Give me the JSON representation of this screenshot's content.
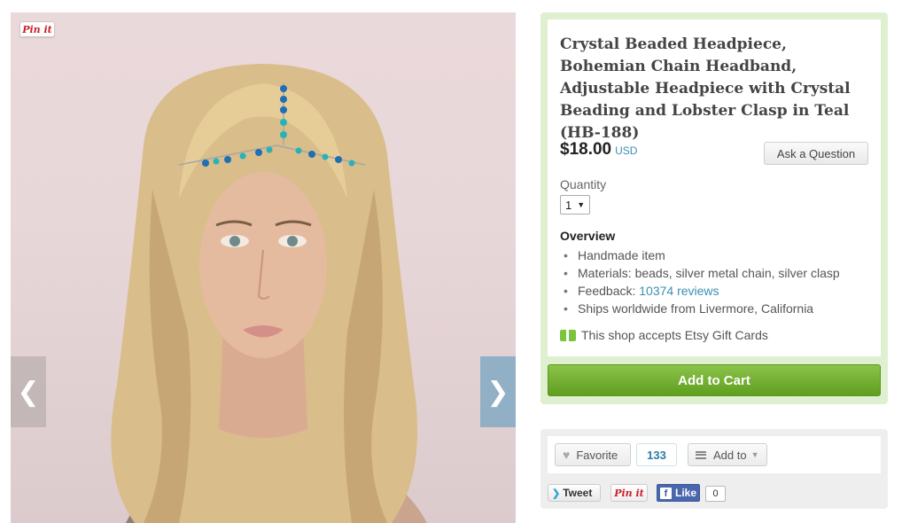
{
  "listing": {
    "title": "Crystal Beaded Headpiece, Bohemian Chain Headband, Adjustable Headpiece with Crystal Beading and Lobster Clasp in Teal (HB-188)",
    "price": "$18.00",
    "currency": "USD",
    "ask_label": "Ask a Question",
    "quantity_label": "Quantity",
    "quantity_value": "1",
    "overview_heading": "Overview",
    "overview": {
      "item1": "Handmade item",
      "item2": "Materials: beads, silver metal chain, silver clasp",
      "item3_prefix": "Feedback: ",
      "item3_link": "10374 reviews",
      "item4": "Ships worldwide from Livermore, California"
    },
    "giftcard_text": "This shop accepts Etsy Gift Cards",
    "add_to_cart_label": "Add to Cart"
  },
  "photo": {
    "pinit_label": "Pin it",
    "prev_icon": "chevron-left-icon",
    "next_icon": "chevron-right-icon",
    "prev_glyph": "❮",
    "next_glyph": "❯"
  },
  "social": {
    "favorite_label": "Favorite",
    "favorite_count": "133",
    "add_to_label": "Add to",
    "tweet_label": "Tweet",
    "pin_label": "Pin it",
    "fb_like_label": "Like",
    "fb_count": "0"
  },
  "colors": {
    "accent_green": "#7cc33e",
    "link_blue": "#3e8eb5",
    "buy_box_bg": "#dff0d0"
  }
}
